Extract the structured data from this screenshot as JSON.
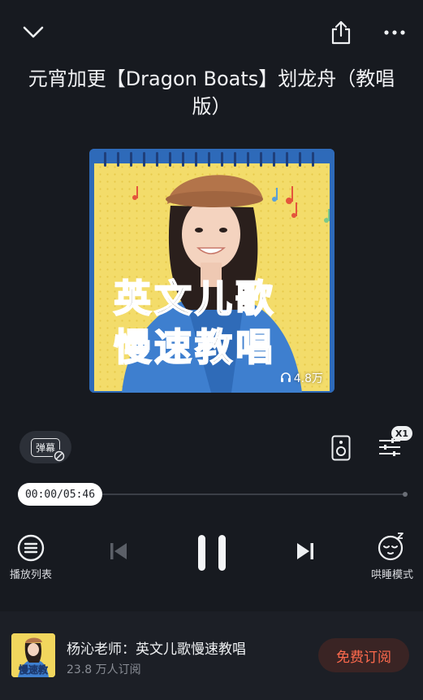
{
  "header": {
    "back_icon": "chevron-down-icon",
    "share_icon": "share-icon",
    "more_icon": "more-icon"
  },
  "track": {
    "title": "元宵加更【Dragon Boats】划龙舟（教唱版）"
  },
  "cover": {
    "line1": "英文儿歌",
    "line2": "慢速教唱",
    "play_count": "4.8万",
    "headphone_icon": "headphone-icon"
  },
  "actions": {
    "danmu_label": "弹幕",
    "danmu_icon": "danmu-off-icon",
    "speaker_icon": "speaker-icon",
    "speed_icon": "speed-adjust-icon",
    "speed_badge": "X1"
  },
  "player": {
    "time_text": "00:00/05:46",
    "progress": 0.0,
    "playlist_label": "播放列表",
    "sleep_label": "哄睡模式",
    "state": "playing"
  },
  "album": {
    "name": "杨沁老师：英文儿歌慢速教唱",
    "subscribers": "23.8 万人订阅",
    "subscribe_label": "免费订阅",
    "thumb_text": "慢速教"
  },
  "colors": {
    "background": "#171a20",
    "accent": "#ff6a4d",
    "cover_yellow": "#f3dc6a",
    "cover_blue": "#2e6ab9"
  }
}
